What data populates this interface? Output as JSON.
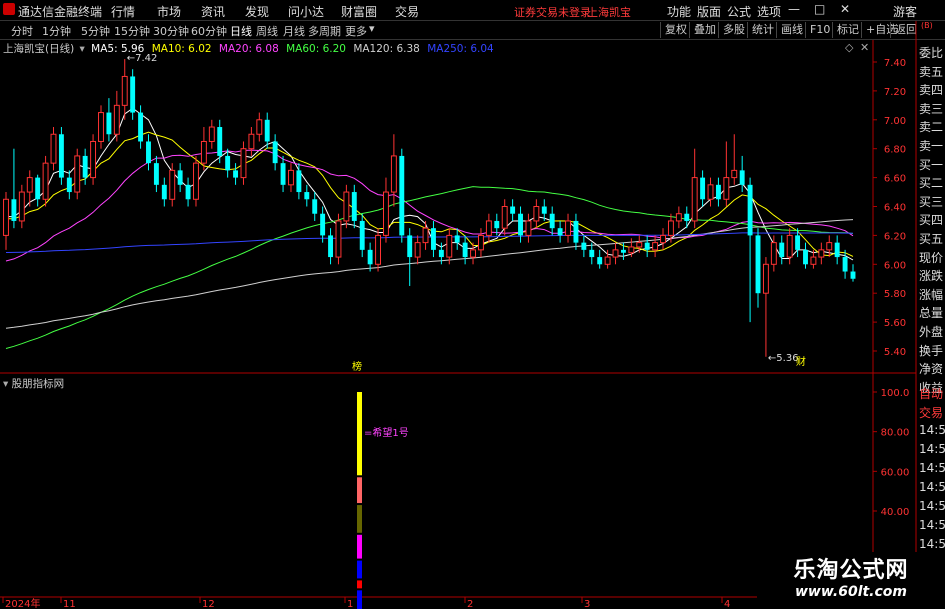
{
  "titlebar": {
    "app_name": "通达信金融终端",
    "menus": [
      "行情",
      "市场",
      "资讯",
      "发现",
      "问小达",
      "财富圈",
      "交易"
    ],
    "warning": "证券交易未登录",
    "stock_name": "上海凯宝",
    "right_menus": [
      "功能",
      "版面",
      "公式",
      "选项"
    ],
    "user": "游客"
  },
  "toolbar": {
    "periods": [
      "分时",
      "1分钟",
      "5分钟",
      "15分钟",
      "30分钟",
      "60分钟",
      "日线",
      "周线",
      "月线",
      "多周期",
      "更多"
    ],
    "active_period": "日线",
    "buttons": [
      "复权",
      "叠加",
      "多股",
      "统计",
      "画线",
      "F10",
      "标记",
      "+自选",
      "返回"
    ]
  },
  "chart_header": {
    "title": "上海凯宝(日线)",
    "ma": [
      {
        "label": "MA5: 5.96",
        "color": "#ffffff"
      },
      {
        "label": "MA10: 6.02",
        "color": "#ffff00"
      },
      {
        "label": "MA20: 6.08",
        "color": "#ff44ff"
      },
      {
        "label": "MA60: 6.20",
        "color": "#44ff44"
      },
      {
        "label": "MA120: 6.38",
        "color": "#d0d0d0"
      },
      {
        "label": "MA250: 6.04",
        "color": "#3344ff"
      }
    ]
  },
  "annotations": {
    "high": "7.42",
    "low": "5.36",
    "bang": "榜",
    "cai": "财",
    "signal": "希望1号"
  },
  "sub_indicator": {
    "title": "股朋指标网"
  },
  "right_panel": {
    "labels": [
      "委比",
      "卖五",
      "卖四",
      "卖三",
      "卖二",
      "卖一",
      "买一",
      "买二",
      "买三",
      "买四",
      "买五",
      "现价",
      "涨跌",
      "涨幅",
      "总量",
      "外盘",
      "换手",
      "净资",
      "收益"
    ],
    "bottom_labels": [
      "自动",
      "交易",
      "14:56",
      "14:56",
      "14:56",
      "14:56",
      "14:56",
      "14:56",
      "14:56",
      "14:56"
    ],
    "top_label": "(B)"
  },
  "brand": {
    "line1": "乐淘公式网",
    "line2": "www.60lt.com"
  },
  "colors": {
    "up": "#ff3333",
    "down": "#00ffff",
    "axis": "#ff3333",
    "bg": "#000000"
  },
  "chart_data": {
    "type": "candlestick",
    "title": "上海凯宝(日线)",
    "price_axis": {
      "min": 5.3,
      "max": 7.5,
      "ticks": [
        "7.40",
        "7.20",
        "7.00",
        "6.80",
        "6.60",
        "6.40",
        "6.20",
        "6.00",
        "5.80",
        "5.60",
        "5.40"
      ]
    },
    "sub_axis": {
      "ticks": [
        "100.0",
        "80.00",
        "60.00",
        "40.00"
      ]
    },
    "x_labels": [
      "2024年",
      "11",
      "12",
      "1",
      "2",
      "3",
      "4"
    ],
    "candles": [
      [
        6.2,
        6.45,
        6.1,
        6.5
      ],
      [
        6.45,
        6.3,
        6.25,
        6.8
      ],
      [
        6.3,
        6.5,
        6.25,
        6.55
      ],
      [
        6.5,
        6.6,
        6.4,
        6.65
      ],
      [
        6.6,
        6.45,
        6.4,
        6.62
      ],
      [
        6.45,
        6.7,
        6.4,
        6.75
      ],
      [
        6.7,
        6.9,
        6.65,
        6.95
      ],
      [
        6.9,
        6.6,
        6.55,
        6.95
      ],
      [
        6.6,
        6.5,
        6.45,
        6.65
      ],
      [
        6.5,
        6.75,
        6.45,
        6.8
      ],
      [
        6.75,
        6.6,
        6.55,
        6.8
      ],
      [
        6.6,
        6.85,
        6.55,
        6.9
      ],
      [
        6.85,
        7.05,
        6.8,
        7.1
      ],
      [
        7.05,
        6.9,
        6.85,
        7.15
      ],
      [
        6.9,
        7.1,
        6.85,
        7.2
      ],
      [
        7.1,
        7.3,
        7.0,
        7.42
      ],
      [
        7.3,
        7.05,
        7.0,
        7.35
      ],
      [
        7.05,
        6.85,
        6.8,
        7.1
      ],
      [
        6.85,
        6.7,
        6.65,
        6.9
      ],
      [
        6.7,
        6.55,
        6.5,
        6.75
      ],
      [
        6.55,
        6.45,
        6.4,
        6.6
      ],
      [
        6.45,
        6.65,
        6.4,
        6.7
      ],
      [
        6.65,
        6.55,
        6.5,
        6.7
      ],
      [
        6.55,
        6.45,
        6.4,
        6.6
      ],
      [
        6.45,
        6.7,
        6.4,
        6.75
      ],
      [
        6.7,
        6.85,
        6.65,
        6.95
      ],
      [
        6.85,
        6.95,
        6.8,
        7.0
      ],
      [
        6.95,
        6.75,
        6.7,
        7.0
      ],
      [
        6.75,
        6.65,
        6.6,
        6.8
      ],
      [
        6.65,
        6.6,
        6.55,
        6.7
      ],
      [
        6.6,
        6.8,
        6.55,
        6.85
      ],
      [
        6.8,
        6.9,
        6.75,
        6.95
      ],
      [
        6.9,
        7.0,
        6.85,
        7.05
      ],
      [
        7.0,
        6.85,
        6.8,
        7.05
      ],
      [
        6.85,
        6.7,
        6.65,
        6.9
      ],
      [
        6.7,
        6.55,
        6.5,
        6.75
      ],
      [
        6.55,
        6.65,
        6.5,
        6.7
      ],
      [
        6.65,
        6.5,
        6.45,
        6.7
      ],
      [
        6.5,
        6.45,
        6.4,
        6.55
      ],
      [
        6.45,
        6.35,
        6.3,
        6.5
      ],
      [
        6.35,
        6.2,
        6.15,
        6.4
      ],
      [
        6.2,
        6.05,
        6.0,
        6.25
      ],
      [
        6.05,
        6.3,
        6.0,
        6.35
      ],
      [
        6.3,
        6.5,
        6.25,
        6.55
      ],
      [
        6.5,
        6.3,
        6.25,
        6.55
      ],
      [
        6.3,
        6.1,
        6.05,
        6.35
      ],
      [
        6.1,
        6.0,
        5.95,
        6.15
      ],
      [
        6.0,
        6.2,
        5.95,
        6.25
      ],
      [
        6.2,
        6.5,
        6.15,
        6.6
      ],
      [
        6.5,
        6.75,
        6.4,
        6.9
      ],
      [
        6.75,
        6.2,
        6.15,
        6.8
      ],
      [
        6.2,
        6.05,
        5.85,
        6.25
      ],
      [
        6.05,
        6.15,
        6.0,
        6.2
      ],
      [
        6.15,
        6.25,
        6.1,
        6.3
      ],
      [
        6.25,
        6.1,
        6.05,
        6.3
      ],
      [
        6.1,
        6.05,
        6.0,
        6.15
      ],
      [
        6.05,
        6.2,
        6.0,
        6.25
      ],
      [
        6.2,
        6.15,
        6.1,
        6.25
      ],
      [
        6.15,
        6.05,
        6.0,
        6.2
      ],
      [
        6.05,
        6.1,
        6.0,
        6.15
      ],
      [
        6.1,
        6.2,
        6.05,
        6.25
      ],
      [
        6.2,
        6.3,
        6.15,
        6.35
      ],
      [
        6.3,
        6.25,
        6.2,
        6.35
      ],
      [
        6.25,
        6.4,
        6.2,
        6.45
      ],
      [
        6.4,
        6.35,
        6.3,
        6.45
      ],
      [
        6.35,
        6.2,
        6.15,
        6.4
      ],
      [
        6.2,
        6.3,
        6.15,
        6.35
      ],
      [
        6.3,
        6.4,
        6.25,
        6.45
      ],
      [
        6.4,
        6.35,
        6.3,
        6.45
      ],
      [
        6.35,
        6.25,
        6.2,
        6.4
      ],
      [
        6.25,
        6.2,
        6.15,
        6.3
      ],
      [
        6.2,
        6.3,
        6.15,
        6.35
      ],
      [
        6.3,
        6.15,
        6.1,
        6.35
      ],
      [
        6.15,
        6.1,
        6.05,
        6.2
      ],
      [
        6.1,
        6.05,
        6.0,
        6.15
      ],
      [
        6.05,
        6.0,
        5.97,
        6.1
      ],
      [
        6.0,
        6.05,
        5.97,
        6.1
      ],
      [
        6.05,
        6.1,
        6.0,
        6.15
      ],
      [
        6.1,
        6.08,
        6.03,
        6.15
      ],
      [
        6.08,
        6.12,
        6.05,
        6.18
      ],
      [
        6.12,
        6.15,
        6.08,
        6.2
      ],
      [
        6.15,
        6.1,
        6.05,
        6.2
      ],
      [
        6.1,
        6.15,
        6.05,
        6.2
      ],
      [
        6.15,
        6.2,
        6.1,
        6.25
      ],
      [
        6.2,
        6.3,
        6.15,
        6.35
      ],
      [
        6.3,
        6.35,
        6.25,
        6.4
      ],
      [
        6.35,
        6.3,
        6.25,
        6.4
      ],
      [
        6.3,
        6.6,
        6.25,
        6.8
      ],
      [
        6.6,
        6.45,
        6.4,
        6.65
      ],
      [
        6.45,
        6.55,
        6.4,
        6.6
      ],
      [
        6.55,
        6.45,
        6.4,
        6.6
      ],
      [
        6.45,
        6.6,
        6.4,
        6.85
      ],
      [
        6.6,
        6.65,
        6.55,
        6.9
      ],
      [
        6.65,
        6.55,
        6.5,
        6.75
      ],
      [
        6.55,
        6.2,
        5.6,
        6.6
      ],
      [
        6.2,
        5.8,
        5.7,
        6.25
      ],
      [
        5.8,
        6.0,
        5.36,
        6.05
      ],
      [
        6.0,
        6.15,
        5.95,
        6.2
      ],
      [
        6.15,
        6.05,
        6.0,
        6.2
      ],
      [
        6.05,
        6.2,
        6.0,
        6.25
      ],
      [
        6.2,
        6.1,
        6.05,
        6.25
      ],
      [
        6.1,
        6.0,
        5.97,
        6.15
      ],
      [
        6.0,
        6.05,
        5.97,
        6.1
      ],
      [
        6.05,
        6.1,
        6.0,
        6.15
      ],
      [
        6.1,
        6.15,
        6.05,
        6.2
      ],
      [
        6.15,
        6.05,
        6.0,
        6.2
      ],
      [
        6.05,
        5.95,
        5.9,
        6.1
      ],
      [
        5.95,
        5.9,
        5.88,
        6.0
      ]
    ],
    "sub_bars": [
      {
        "color": "#ffff00",
        "value": 100
      },
      {
        "color": "#ff6666",
        "value": 57
      },
      {
        "color": "#666600",
        "value": 43
      },
      {
        "color": "#ff00ff",
        "value": 28
      },
      {
        "color": "#0000ff",
        "value": 15
      },
      {
        "color": "#ff0000",
        "value": 5
      },
      {
        "color": "#0000ff",
        "value": 0
      }
    ]
  }
}
